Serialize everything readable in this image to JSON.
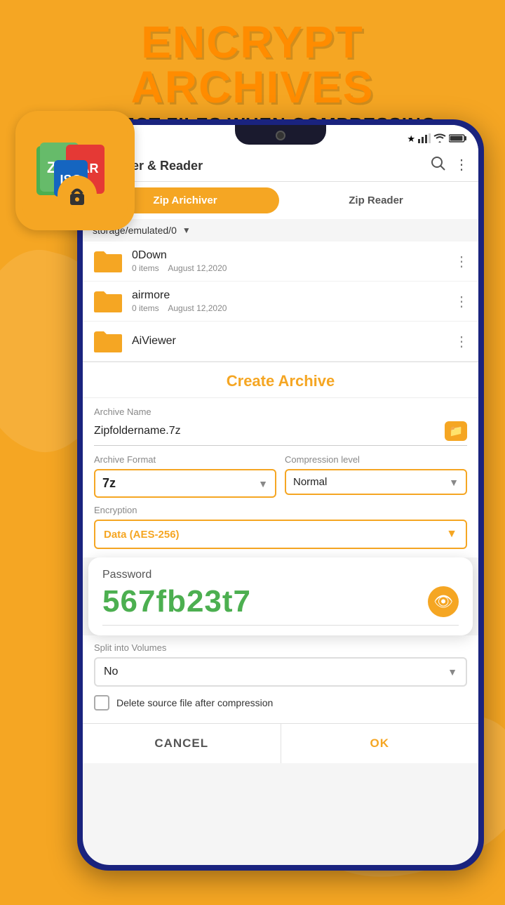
{
  "page": {
    "background_color": "#F5A623"
  },
  "header": {
    "main_title": "ENCRYPT ARCHIVES",
    "sub_title": "PROTECT FILES WHEN COMPRESSING"
  },
  "phone": {
    "status_bar": {
      "bluetooth_icon": "⚙",
      "signal_icon": "📶",
      "wifi_icon": "WiFi",
      "battery_icon": "🔋"
    },
    "topbar": {
      "title": "Archiver & Reader",
      "search_icon": "🔍",
      "more_icon": "⋮"
    },
    "tabs": [
      {
        "label": "Zip Arichiver",
        "active": true
      },
      {
        "label": "Zip Reader",
        "active": false
      }
    ],
    "path": {
      "text": "storage/emulated/0",
      "dropdown_arrow": "▼"
    },
    "files": [
      {
        "name": "0Down",
        "items": "0 items",
        "date": "August 12,2020"
      },
      {
        "name": "airmore",
        "items": "0 items",
        "date": "August 12,2020"
      },
      {
        "name": "AiViewer",
        "items": "",
        "date": ""
      }
    ],
    "create_archive": {
      "title": "Create Archive",
      "archive_name_label": "Archive Name",
      "archive_name_value": "Zipfoldername.7z",
      "archive_format_label": "Archive Format",
      "archive_format_value": "7z",
      "compression_level_label": "Compression level",
      "compression_level_value": "Normal",
      "encryption_label": "Encryption",
      "encryption_value": "Data (AES-256)",
      "password_label": "Password",
      "password_value": "567fb23t7",
      "split_volumes_label": "Split into Volumes",
      "split_volumes_value": "No",
      "delete_source_label": "Delete source file after compression",
      "cancel_button": "CANCEL",
      "ok_button": "OK"
    }
  }
}
